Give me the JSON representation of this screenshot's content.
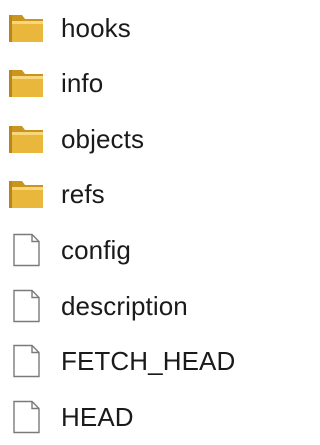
{
  "colors": {
    "folder_body": "#e8b73c",
    "folder_dark": "#c9951e",
    "folder_light": "#f7d77a",
    "file_outline": "#7a7a7a",
    "file_fill": "#ffffff",
    "text": "#1a1a1a"
  },
  "items": [
    {
      "name": "hooks",
      "icon": "folder-icon"
    },
    {
      "name": "info",
      "icon": "folder-icon"
    },
    {
      "name": "objects",
      "icon": "folder-icon"
    },
    {
      "name": "refs",
      "icon": "folder-icon"
    },
    {
      "name": "config",
      "icon": "file-icon"
    },
    {
      "name": "description",
      "icon": "file-icon"
    },
    {
      "name": "FETCH_HEAD",
      "icon": "file-icon"
    },
    {
      "name": "HEAD",
      "icon": "file-icon"
    }
  ]
}
